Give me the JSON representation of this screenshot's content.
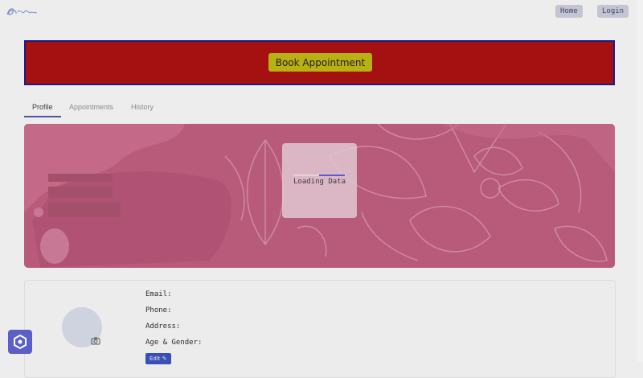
{
  "header": {
    "logo_icon": "signature-logo-icon",
    "nav": {
      "home": "Home",
      "login": "Login"
    }
  },
  "banner": {
    "book_label": "Book Appointment",
    "colors": {
      "background": "#a51111",
      "border": "#1a1a8a",
      "button": "#b9b014"
    }
  },
  "tabs": [
    {
      "label": "Profile",
      "active": true
    },
    {
      "label": "Appointments",
      "active": false
    },
    {
      "label": "History",
      "active": false
    }
  ],
  "hero": {
    "loading_text": "Loading Data",
    "background_color": "#b85b7b"
  },
  "profile": {
    "fields": {
      "email": "Email:",
      "phone": "Phone:",
      "address": "Address:",
      "age_gender": "Age & Gender:"
    },
    "edit_label": "Edit ✎",
    "camera_icon": "camera-icon"
  },
  "chat": {
    "icon": "chat-widget-icon",
    "color": "#5b5fc7"
  }
}
